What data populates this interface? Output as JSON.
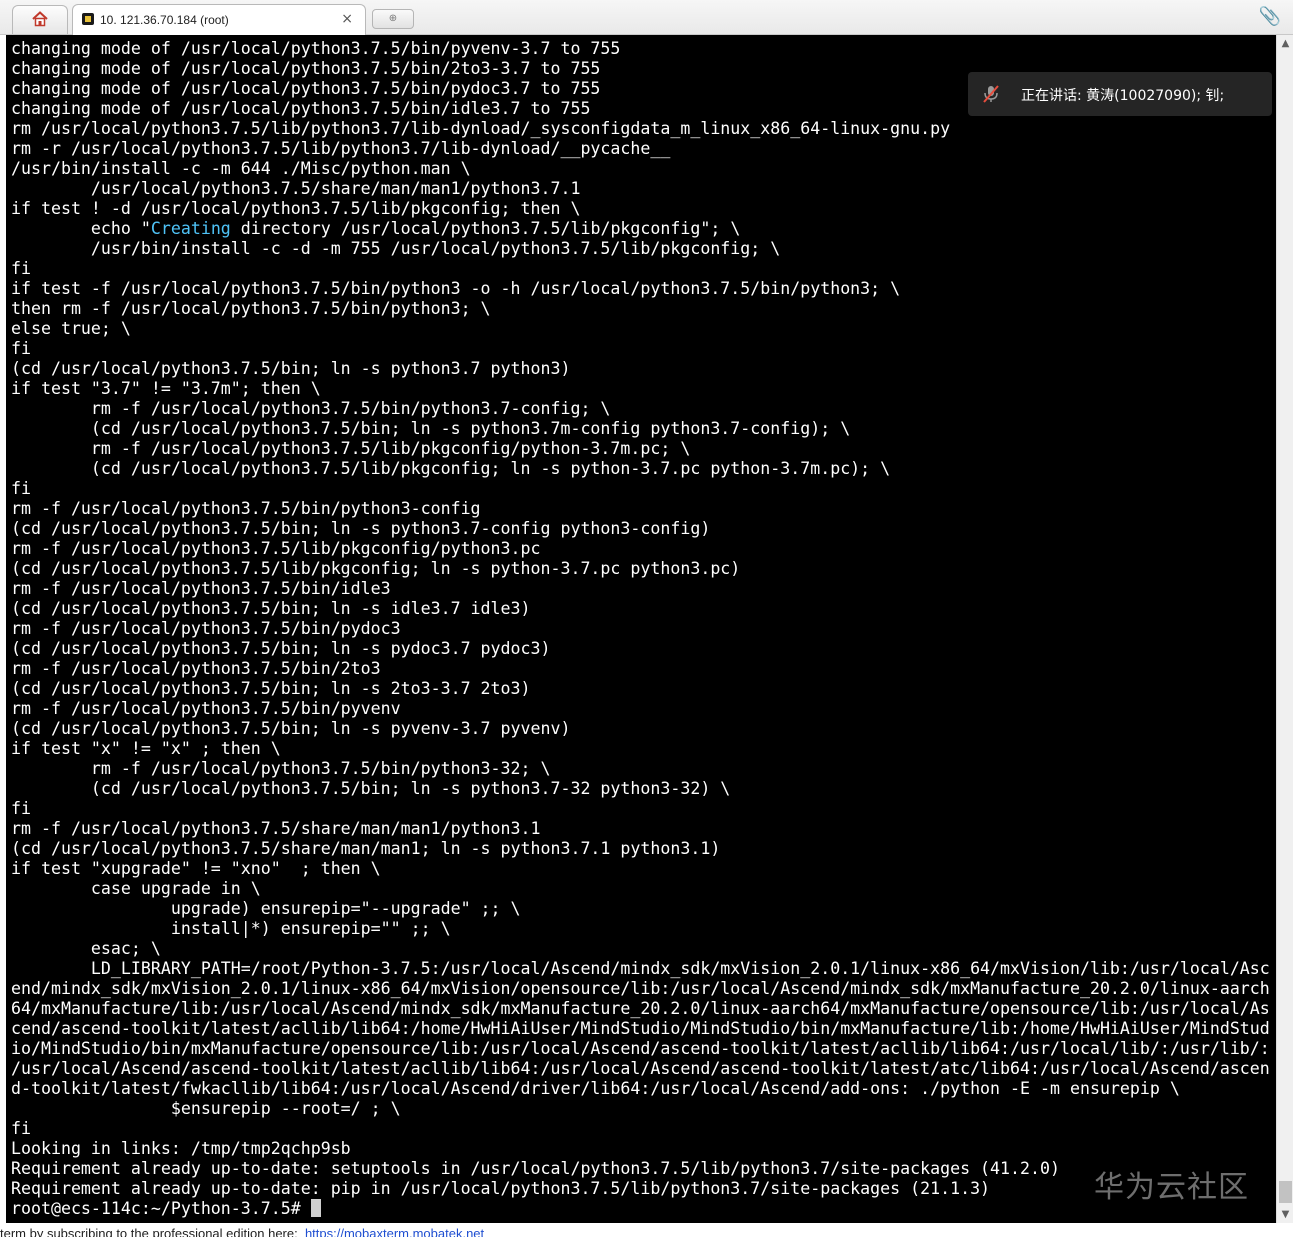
{
  "tabs": {
    "home_label": "home",
    "session_title": "10. 121.36.70.184 (root)",
    "close_glyph": "×",
    "new_tab_glyph": "⊕"
  },
  "meeting": {
    "speaking_text": "正在讲话: 黄涛(10027090); 钊;"
  },
  "watermark": "华为云社区",
  "terminal": {
    "line_before": "        echo \"",
    "highlight": "Creating",
    "line_after": " directory /usr/local/python3.7.5/lib/pkgconfig\"; \\",
    "lines_a": [
      "changing mode of /usr/local/python3.7.5/bin/pyvenv-3.7 to 755",
      "changing mode of /usr/local/python3.7.5/bin/2to3-3.7 to 755",
      "changing mode of /usr/local/python3.7.5/bin/pydoc3.7 to 755",
      "changing mode of /usr/local/python3.7.5/bin/idle3.7 to 755",
      "rm /usr/local/python3.7.5/lib/python3.7/lib-dynload/_sysconfigdata_m_linux_x86_64-linux-gnu.py",
      "rm -r /usr/local/python3.7.5/lib/python3.7/lib-dynload/__pycache__",
      "/usr/bin/install -c -m 644 ./Misc/python.man \\",
      "        /usr/local/python3.7.5/share/man/man1/python3.7.1",
      "if test ! -d /usr/local/python3.7.5/lib/pkgconfig; then \\"
    ],
    "lines_b": [
      "        /usr/bin/install -c -d -m 755 /usr/local/python3.7.5/lib/pkgconfig; \\",
      "fi",
      "if test -f /usr/local/python3.7.5/bin/python3 -o -h /usr/local/python3.7.5/bin/python3; \\",
      "then rm -f /usr/local/python3.7.5/bin/python3; \\",
      "else true; \\",
      "fi",
      "(cd /usr/local/python3.7.5/bin; ln -s python3.7 python3)",
      "if test \"3.7\" != \"3.7m\"; then \\",
      "        rm -f /usr/local/python3.7.5/bin/python3.7-config; \\",
      "        (cd /usr/local/python3.7.5/bin; ln -s python3.7m-config python3.7-config); \\",
      "        rm -f /usr/local/python3.7.5/lib/pkgconfig/python-3.7m.pc; \\",
      "        (cd /usr/local/python3.7.5/lib/pkgconfig; ln -s python-3.7.pc python-3.7m.pc); \\",
      "fi",
      "rm -f /usr/local/python3.7.5/bin/python3-config",
      "(cd /usr/local/python3.7.5/bin; ln -s python3.7-config python3-config)",
      "rm -f /usr/local/python3.7.5/lib/pkgconfig/python3.pc",
      "(cd /usr/local/python3.7.5/lib/pkgconfig; ln -s python-3.7.pc python3.pc)",
      "rm -f /usr/local/python3.7.5/bin/idle3",
      "(cd /usr/local/python3.7.5/bin; ln -s idle3.7 idle3)",
      "rm -f /usr/local/python3.7.5/bin/pydoc3",
      "(cd /usr/local/python3.7.5/bin; ln -s pydoc3.7 pydoc3)",
      "rm -f /usr/local/python3.7.5/bin/2to3",
      "(cd /usr/local/python3.7.5/bin; ln -s 2to3-3.7 2to3)",
      "rm -f /usr/local/python3.7.5/bin/pyvenv",
      "(cd /usr/local/python3.7.5/bin; ln -s pyvenv-3.7 pyvenv)",
      "if test \"x\" != \"x\" ; then \\",
      "        rm -f /usr/local/python3.7.5/bin/python3-32; \\",
      "        (cd /usr/local/python3.7.5/bin; ln -s python3.7-32 python3-32) \\",
      "fi",
      "rm -f /usr/local/python3.7.5/share/man/man1/python3.1",
      "(cd /usr/local/python3.7.5/share/man/man1; ln -s python3.7.1 python3.1)",
      "if test \"xupgrade\" != \"xno\"  ; then \\",
      "        case upgrade in \\",
      "                upgrade) ensurepip=\"--upgrade\" ;; \\",
      "                install|*) ensurepip=\"\" ;; \\",
      "        esac; \\",
      "        LD_LIBRARY_PATH=/root/Python-3.7.5:/usr/local/Ascend/mindx_sdk/mxVision_2.0.1/linux-x86_64/mxVision/lib:/usr/local/Asc",
      "end/mindx_sdk/mxVision_2.0.1/linux-x86_64/mxVision/opensource/lib:/usr/local/Ascend/mindx_sdk/mxManufacture_20.2.0/linux-aarch",
      "64/mxManufacture/lib:/usr/local/Ascend/mindx_sdk/mxManufacture_20.2.0/linux-aarch64/mxManufacture/opensource/lib:/usr/local/As",
      "cend/ascend-toolkit/latest/acllib/lib64:/home/HwHiAiUser/MindStudio/MindStudio/bin/mxManufacture/lib:/home/HwHiAiUser/MindStud",
      "io/MindStudio/bin/mxManufacture/opensource/lib:/usr/local/Ascend/ascend-toolkit/latest/acllib/lib64:/usr/local/lib/:/usr/lib/:",
      "/usr/local/Ascend/ascend-toolkit/latest/acllib/lib64:/usr/local/Ascend/ascend-toolkit/latest/atc/lib64:/usr/local/Ascend/ascen",
      "d-toolkit/latest/fwkacllib/lib64:/usr/local/Ascend/driver/lib64:/usr/local/Ascend/add-ons: ./python -E -m ensurepip \\",
      "                $ensurepip --root=/ ; \\",
      "fi",
      "Looking in links: /tmp/tmp2qchp9sb",
      "Requirement already up-to-date: setuptools in /usr/local/python3.7.5/lib/python3.7/site-packages (41.2.0)",
      "Requirement already up-to-date: pip in /usr/local/python3.7.5/lib/python3.7/site-packages (21.1.3)"
    ],
    "prompt": "root@ecs-114c:~/Python-3.7.5# "
  },
  "statusbar": {
    "text": "term by subscribing to the professional edition here:",
    "link": "https://mobaxterm.mobatek.net"
  },
  "colors": {
    "terminal_bg": "#000000",
    "terminal_fg": "#ffffff",
    "highlight": "#4fc3f7",
    "link": "#1f4fd1",
    "attach_icon": "#2b63c6"
  }
}
